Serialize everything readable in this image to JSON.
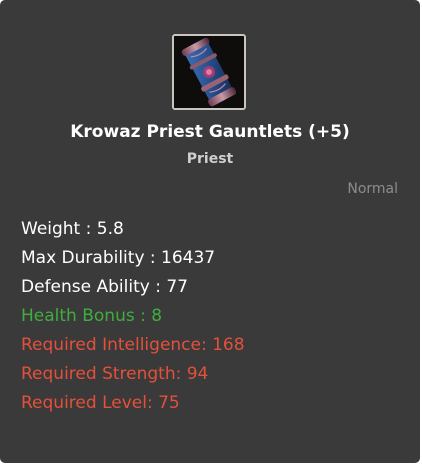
{
  "item": {
    "icon": "gauntlets-icon",
    "name": "Krowaz Priest Gauntlets (+5)",
    "class": "Priest",
    "grade": "Normal"
  },
  "stats": [
    {
      "text": "Weight : 5.8",
      "color": "#ffffff"
    },
    {
      "text": "Max Durability : 16437",
      "color": "#ffffff"
    },
    {
      "text": "Defense Ability : 77",
      "color": "#ffffff"
    },
    {
      "text": "Health Bonus : 8",
      "color": "#3fae3f"
    },
    {
      "text": "Required Intelligence: 168",
      "color": "#e5503b"
    },
    {
      "text": "Required Strength: 94",
      "color": "#e5503b"
    },
    {
      "text": "Required Level: 75",
      "color": "#e5503b"
    }
  ]
}
